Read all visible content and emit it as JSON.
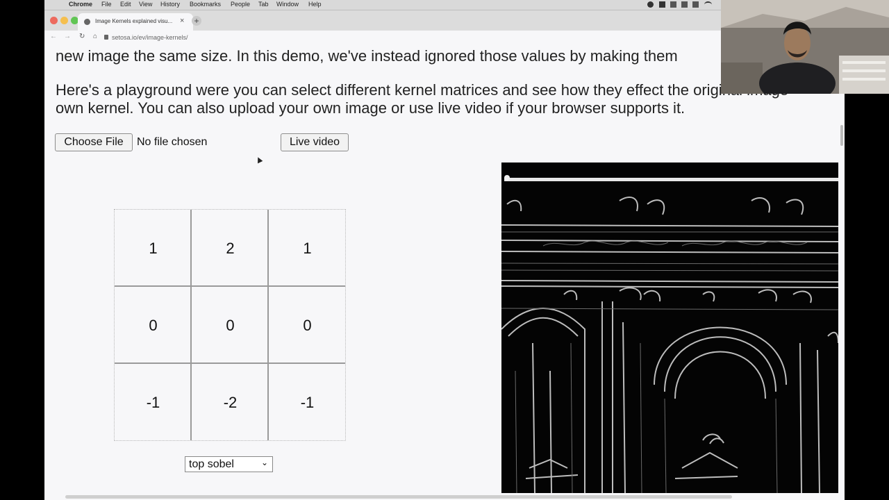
{
  "menubar": {
    "app": "Chrome",
    "items": [
      "File",
      "Edit",
      "View",
      "History",
      "Bookmarks",
      "People",
      "Tab",
      "Window",
      "Help"
    ]
  },
  "tab": {
    "title": "Image Kernels explained visu...",
    "close": "×"
  },
  "newtab": "+",
  "address": {
    "back": "←",
    "forward": "→",
    "reload": "↻",
    "home": "⌂",
    "url": "setosa.io/ev/image-kernels/"
  },
  "content": {
    "para1": "new image the same size. In this demo, we've instead ignored those values by making them",
    "para2_line1": "Here's a playground were you can select different kernel matrices and see how they effect the original image",
    "para2_line2": "own kernel. You can also upload your own image or use live video if your browser supports it.",
    "choose_file": "Choose File",
    "no_file": "No file chosen",
    "live_video": "Live video",
    "kernel": [
      [
        "1",
        "2",
        "1"
      ],
      [
        "0",
        "0",
        "0"
      ],
      [
        "-1",
        "-2",
        "-1"
      ]
    ],
    "preset": "top sobel"
  },
  "colors": {
    "page_bg": "#f7f7f9",
    "filtered_bg": "#040404",
    "grid_line": "#9a9a9a"
  },
  "icons": {
    "dropdown": "chevron-down-icon",
    "tab_favicon": "globe-icon",
    "cursor": "mouse-pointer-icon"
  }
}
